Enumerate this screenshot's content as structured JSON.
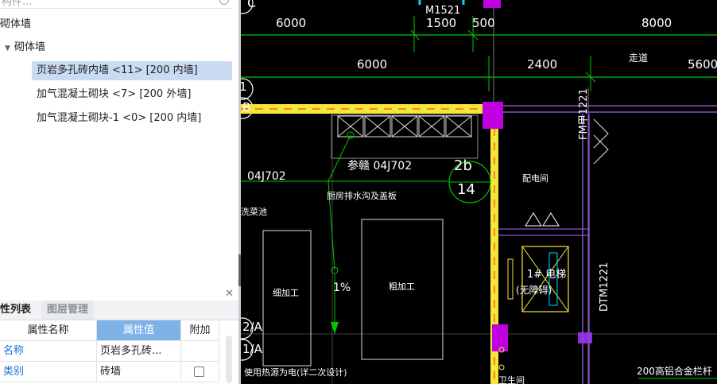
{
  "tree": {
    "search_placeholder": "构件...",
    "root_label": "砌体墙",
    "group_label": "砌体墙",
    "items": [
      {
        "label": "页岩多孔砖内墙 <11> [200 内墙]",
        "selected": true
      },
      {
        "label": "加气混凝土砌块 <7> [200 外墙]",
        "selected": false
      },
      {
        "label": "加气混凝土砌块-1 <0> [200 内墙]",
        "selected": false
      }
    ]
  },
  "properties": {
    "tabs": [
      {
        "label": "性列表",
        "active": true
      },
      {
        "label": "图层管理",
        "active": false
      }
    ],
    "columns": [
      "属性名称",
      "属性值",
      "附加"
    ],
    "rows": [
      {
        "name": "名称",
        "value": "页岩多孔砖...",
        "has_checkbox": false
      },
      {
        "name": "类别",
        "value": "砖墙",
        "has_checkbox": true
      }
    ]
  },
  "drawing": {
    "axis_labels": [
      "C",
      "B",
      "1",
      "2/A",
      "1/A"
    ],
    "dimensions_top": [
      "6000",
      "1500",
      "500",
      "8000"
    ],
    "door_label": "M1521",
    "dimensions_second": [
      "6000",
      "2400",
      "5600"
    ],
    "corridor_label": "走道",
    "distribution_room": "配电间",
    "fm_label": "FM甲1221",
    "dtm_label": "DTM1221",
    "ref_text": "参赣 04J702",
    "ref_detail_top": "2b",
    "ref_detail_bottom": "14",
    "left_ref": "04J702",
    "drain_note": "厨房排水沟及盖板",
    "sink_note": "洗菜池",
    "fine_process": "细加工",
    "rough_process": "粗加工",
    "slope": "1%",
    "elevator": "1# 电梯",
    "elevator_sub": "(无障碍)",
    "power_note": "使用热源为电(详二次设计)",
    "railing_note": "200高铝合金栏杆",
    "bottom_fragment": "卫生间"
  },
  "colors": {
    "canvas_bg": "#000000",
    "axis_green": "#00c800",
    "wall_yellow": "#f5e63a",
    "column_magenta": "#c000e0",
    "dim_white": "#ffffff",
    "selection_blue": "#c9dbf2",
    "header_blue": "#7fb3e8"
  }
}
